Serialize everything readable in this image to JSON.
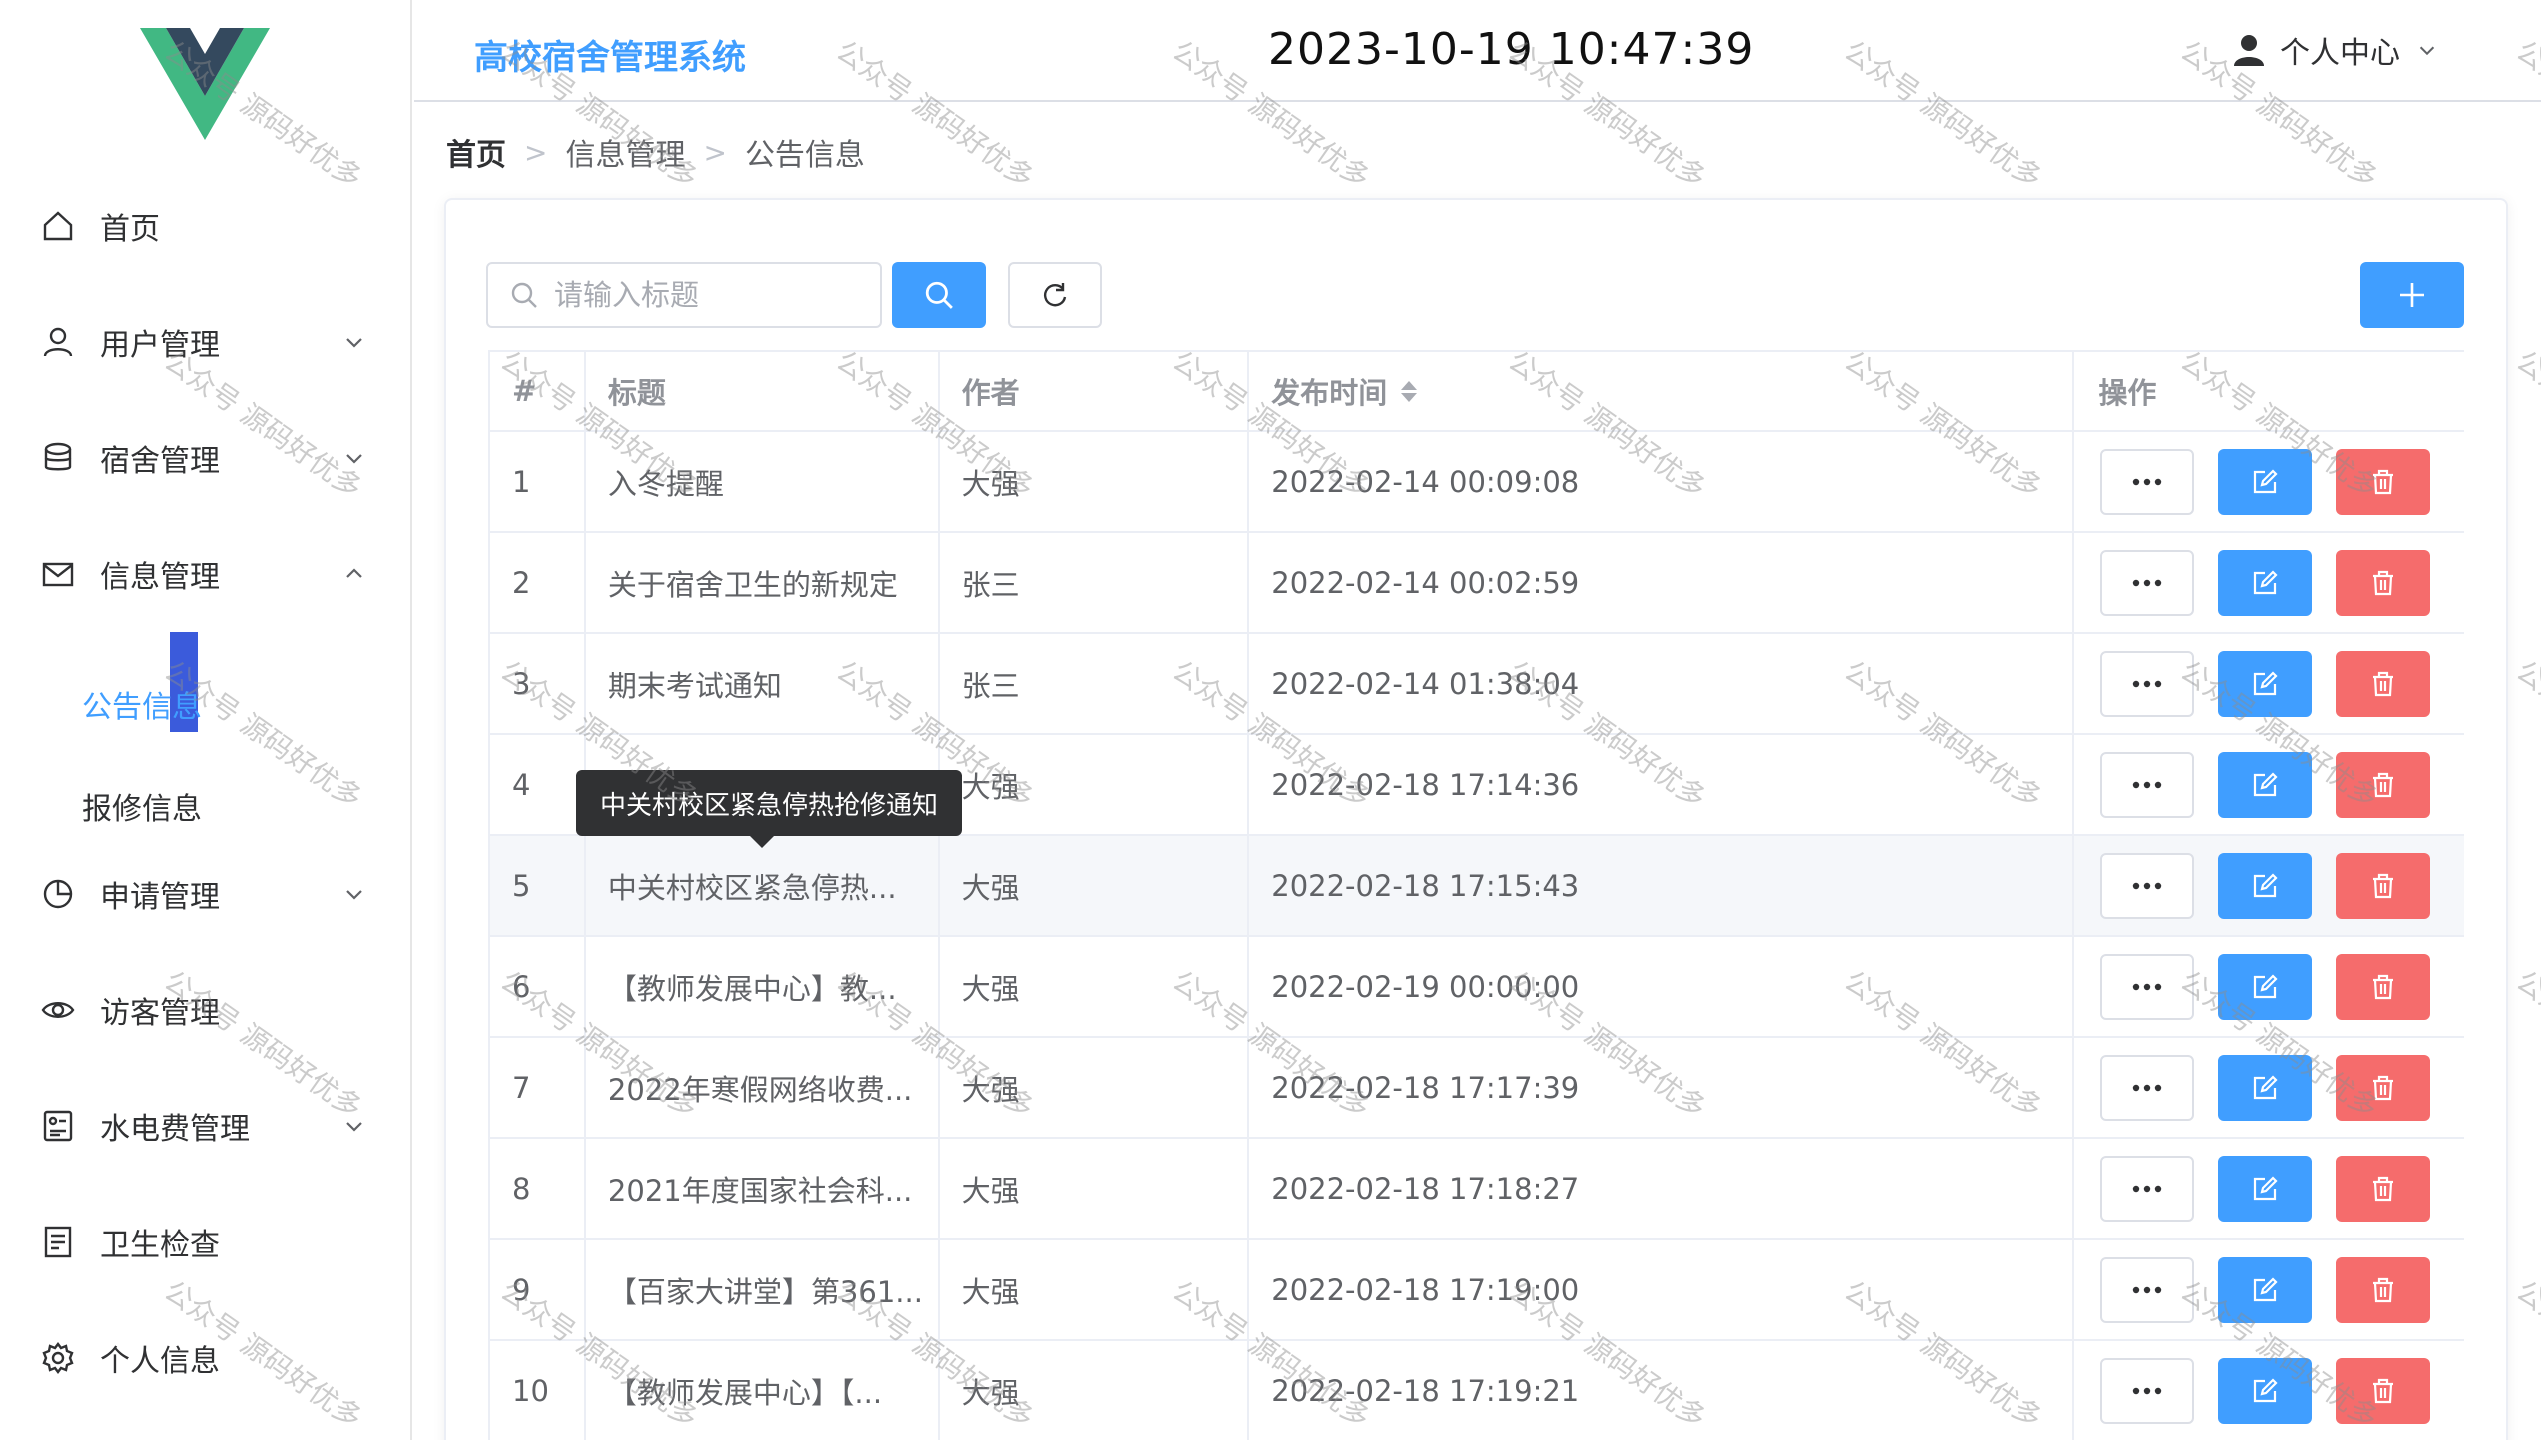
{
  "header": {
    "system_title": "高校宿舍管理系统",
    "clock": "2023-10-19 10:47:39",
    "user_center_label": "个人中心"
  },
  "sidebar": {
    "items": [
      {
        "label": "首页",
        "icon": "home-icon"
      },
      {
        "label": "用户管理",
        "icon": "user-icon"
      },
      {
        "label": "宿舍管理",
        "icon": "database-icon"
      },
      {
        "label": "信息管理",
        "icon": "message-icon"
      },
      {
        "label": "申请管理",
        "icon": "pie-chart-icon"
      },
      {
        "label": "访客管理",
        "icon": "eye-icon"
      },
      {
        "label": "水电费管理",
        "icon": "meter-icon"
      },
      {
        "label": "卫生检查",
        "icon": "document-icon"
      },
      {
        "label": "个人信息",
        "icon": "setting-icon"
      }
    ],
    "sub_items": [
      {
        "label": "公告信息",
        "active": true
      },
      {
        "label": "报修信息",
        "active": false
      }
    ]
  },
  "breadcrumb": [
    "首页",
    "信息管理",
    "公告信息"
  ],
  "search": {
    "placeholder": "请输入标题"
  },
  "table": {
    "columns": [
      "#",
      "标题",
      "作者",
      "发布时间",
      "操作"
    ],
    "rows": [
      {
        "idx": "1",
        "title": "入冬提醒",
        "author": "大强",
        "time": "2022-02-14 00:09:08"
      },
      {
        "idx": "2",
        "title": "关于宿舍卫生的新规定",
        "author": "张三",
        "time": "2022-02-14 00:02:59"
      },
      {
        "idx": "3",
        "title": "期末考试通知",
        "author": "张三",
        "time": "2022-02-14 01:38:04"
      },
      {
        "idx": "4",
        "title": "",
        "author": "大强",
        "time": "2022-02-18 17:14:36"
      },
      {
        "idx": "5",
        "title": "中关村校区紧急停热...",
        "author": "大强",
        "time": "2022-02-18 17:15:43"
      },
      {
        "idx": "6",
        "title": "【教师发展中心】教...",
        "author": "大强",
        "time": "2022-02-19 00:00:00"
      },
      {
        "idx": "7",
        "title": "2022年寒假网络收费...",
        "author": "大强",
        "time": "2022-02-18 17:17:39"
      },
      {
        "idx": "8",
        "title": "2021年度国家社会科...",
        "author": "大强",
        "time": "2022-02-18 17:18:27"
      },
      {
        "idx": "9",
        "title": "【百家大讲堂】第361...",
        "author": "大强",
        "time": "2022-02-18 17:19:00"
      },
      {
        "idx": "10",
        "title": "【教师发展中心】【...",
        "author": "大强",
        "time": "2022-02-18 17:19:21"
      }
    ]
  },
  "tooltip": {
    "text": "中关村校区紧急停热抢修通知"
  },
  "watermark": {
    "text": "公众号 源码好优多"
  },
  "colors": {
    "primary": "#409eff",
    "danger": "#f56c6c",
    "logo_green": "#41b883",
    "logo_dark": "#34495e",
    "active_bar": "#3b5bdb"
  }
}
